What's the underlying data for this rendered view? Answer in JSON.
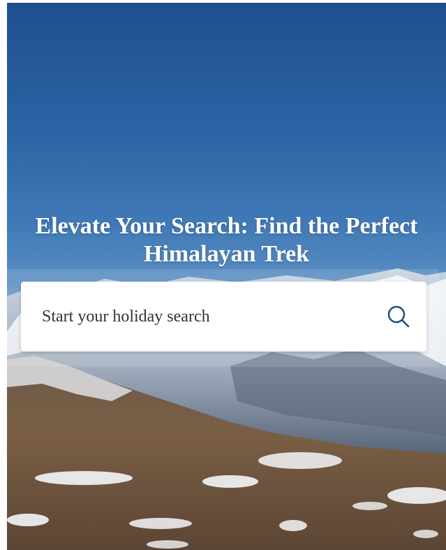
{
  "hero": {
    "title": "Elevate Your Search: Find the Perfect Himalayan Trek"
  },
  "search": {
    "placeholder": "Start your holiday search",
    "icon": "search-icon",
    "accent_color": "#1f4a7a"
  },
  "colors": {
    "sky_top": "#1f4f8f",
    "title_text": "#ffffff",
    "search_box_bg": "#ffffff"
  }
}
